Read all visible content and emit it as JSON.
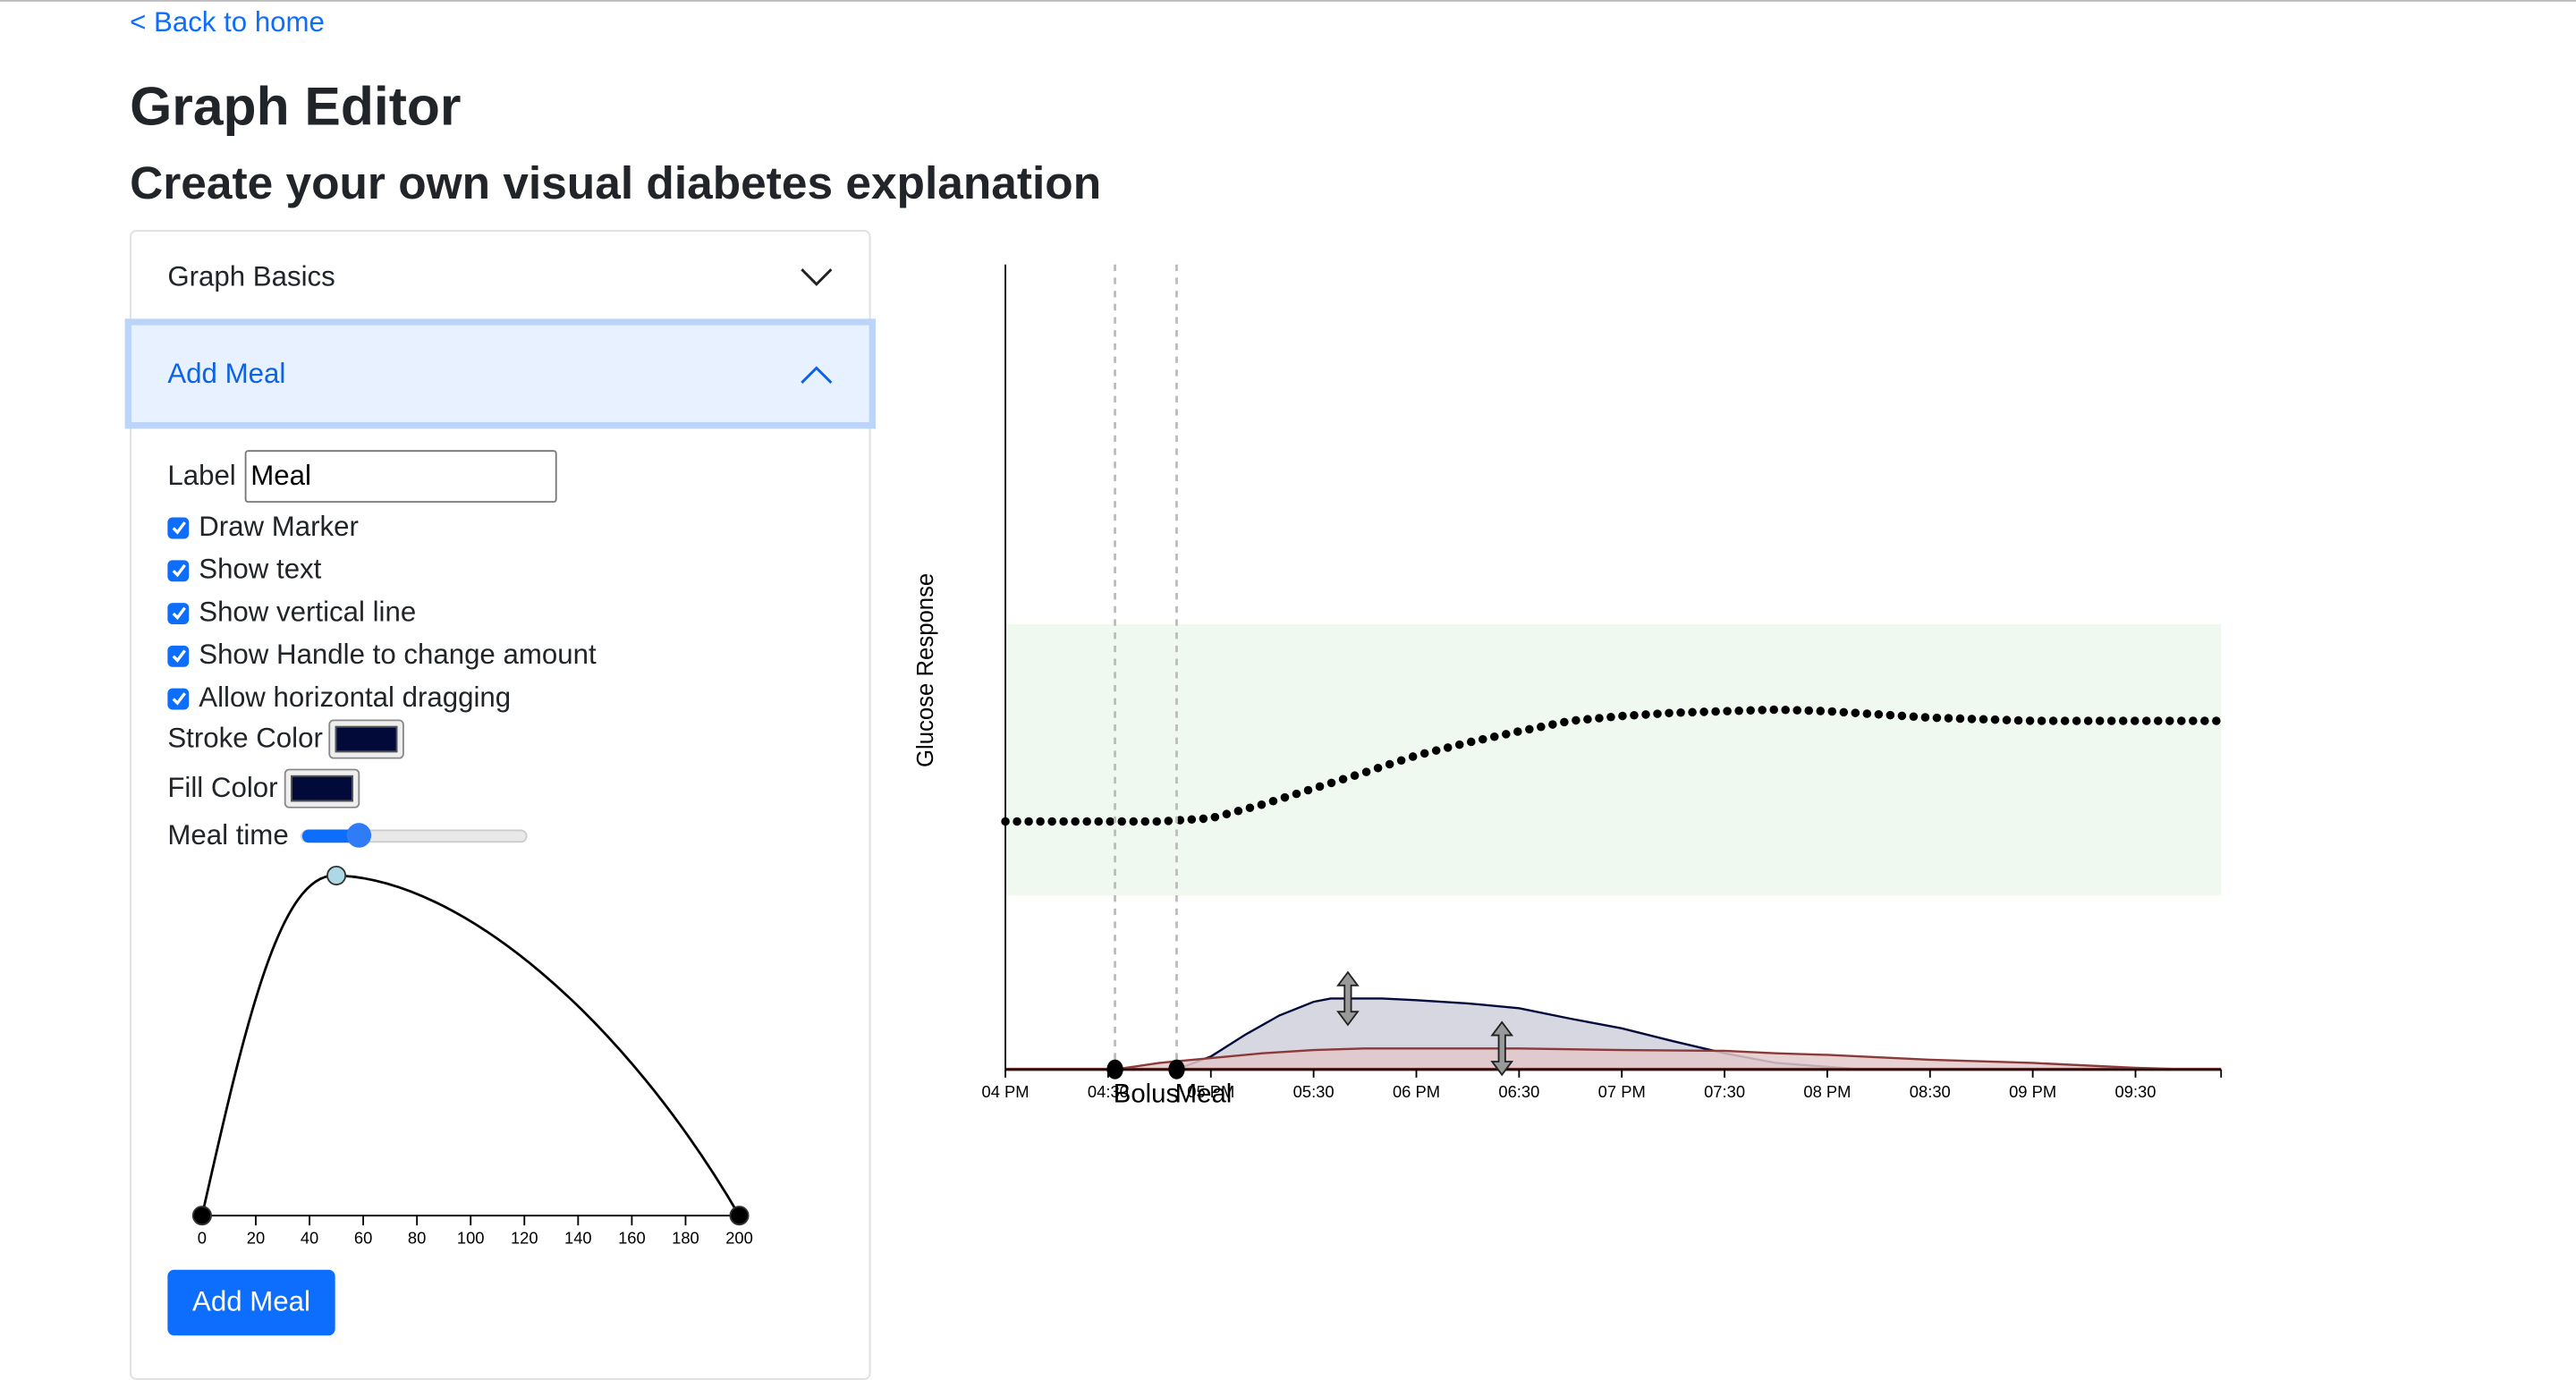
{
  "nav": {
    "back_label": "< Back to home"
  },
  "header": {
    "title": "Graph Editor",
    "subtitle": "Create your own visual diabetes explanation"
  },
  "accordion": {
    "sections": [
      {
        "label": "Graph Basics",
        "expanded": false
      },
      {
        "label": "Add Meal",
        "expanded": true
      }
    ],
    "form": {
      "label_caption": "Label",
      "label_value": "Meal",
      "checkboxes": [
        {
          "label": "Draw Marker",
          "checked": true
        },
        {
          "label": "Show text",
          "checked": true
        },
        {
          "label": "Show vertical line",
          "checked": true
        },
        {
          "label": "Show Handle to change amount",
          "checked": true
        },
        {
          "label": "Allow horizontal dragging",
          "checked": true
        }
      ],
      "stroke_color_label": "Stroke Color",
      "stroke_color": "#020a3a",
      "fill_color_label": "Fill Color",
      "fill_color": "#020a3a",
      "meal_time_label": "Meal time",
      "meal_time_fraction": 0.25,
      "add_button": "Add Meal"
    },
    "meal_shape": {
      "x_ticks": [
        "0",
        "20",
        "40",
        "60",
        "80",
        "100",
        "120",
        "140",
        "160",
        "180",
        "200"
      ],
      "xlim": [
        0,
        200
      ],
      "points": [
        [
          0,
          0
        ],
        [
          50,
          1
        ],
        [
          200,
          0
        ]
      ]
    }
  },
  "chart_data": {
    "type": "area",
    "ylabel": "Glucose Response",
    "xlabel": "",
    "x_ticks": [
      "04 PM",
      "04:30",
      "05 PM",
      "05:30",
      "06 PM",
      "06:30",
      "07 PM",
      "07:30",
      "08 PM",
      "08:30",
      "09 PM",
      "09:30"
    ],
    "xlim": [
      "16:00",
      "21:55"
    ],
    "ylim": [
      0,
      100
    ],
    "target_range": [
      21.6,
      55.3
    ],
    "target_color": "#eff9f0",
    "markers": [
      {
        "label": "Bolus",
        "time": "16:32"
      },
      {
        "label": "Meal",
        "time": "16:50"
      }
    ],
    "series": [
      {
        "kind": "glucose",
        "style": "dotted",
        "color": "#000000",
        "points": [
          [
            "16:00",
            30.8
          ],
          [
            "16:45",
            30.8
          ],
          [
            "17:00",
            31.2
          ],
          [
            "17:15",
            32.9
          ],
          [
            "17:30",
            34.9
          ],
          [
            "17:45",
            36.9
          ],
          [
            "18:00",
            39.0
          ],
          [
            "18:15",
            40.6
          ],
          [
            "18:30",
            42.0
          ],
          [
            "18:45",
            43.3
          ],
          [
            "19:00",
            43.9
          ],
          [
            "19:15",
            44.3
          ],
          [
            "19:30",
            44.5
          ],
          [
            "19:45",
            44.7
          ],
          [
            "20:00",
            44.5
          ],
          [
            "20:15",
            44.1
          ],
          [
            "20:30",
            43.7
          ],
          [
            "20:45",
            43.5
          ],
          [
            "21:00",
            43.3
          ],
          [
            "21:55",
            43.3
          ]
        ]
      },
      {
        "kind": "meal",
        "style": "area",
        "color": "#020a3a",
        "fill": "#cfd0dc",
        "points": [
          [
            "16:50",
            0
          ],
          [
            "17:00",
            1.6
          ],
          [
            "17:10",
            4.3
          ],
          [
            "17:20",
            6.7
          ],
          [
            "17:30",
            8.4
          ],
          [
            "17:35",
            8.8
          ],
          [
            "17:50",
            8.8
          ],
          [
            "18:00",
            8.6
          ],
          [
            "18:15",
            8.2
          ],
          [
            "18:30",
            7.6
          ],
          [
            "18:45",
            6.3
          ],
          [
            "19:00",
            5.1
          ],
          [
            "19:15",
            3.5
          ],
          [
            "19:30",
            2.0
          ],
          [
            "19:45",
            0.8
          ],
          [
            "20:10",
            0
          ]
        ]
      },
      {
        "kind": "bolus",
        "style": "area",
        "color": "#8b3a3a",
        "fill": "#e3c9cb",
        "points": [
          [
            "16:32",
            0
          ],
          [
            "16:45",
            0.8
          ],
          [
            "17:00",
            1.4
          ],
          [
            "17:15",
            2.0
          ],
          [
            "17:30",
            2.4
          ],
          [
            "17:45",
            2.6
          ],
          [
            "18:30",
            2.6
          ],
          [
            "19:00",
            2.4
          ],
          [
            "19:30",
            2.3
          ],
          [
            "19:45",
            2.0
          ],
          [
            "20:00",
            1.8
          ],
          [
            "20:30",
            1.2
          ],
          [
            "21:00",
            0.8
          ],
          [
            "21:30",
            0.2
          ],
          [
            "21:45",
            0
          ]
        ]
      }
    ],
    "handles": [
      {
        "series": "meal",
        "time": "17:40"
      },
      {
        "series": "bolus",
        "time": "18:25"
      }
    ]
  }
}
